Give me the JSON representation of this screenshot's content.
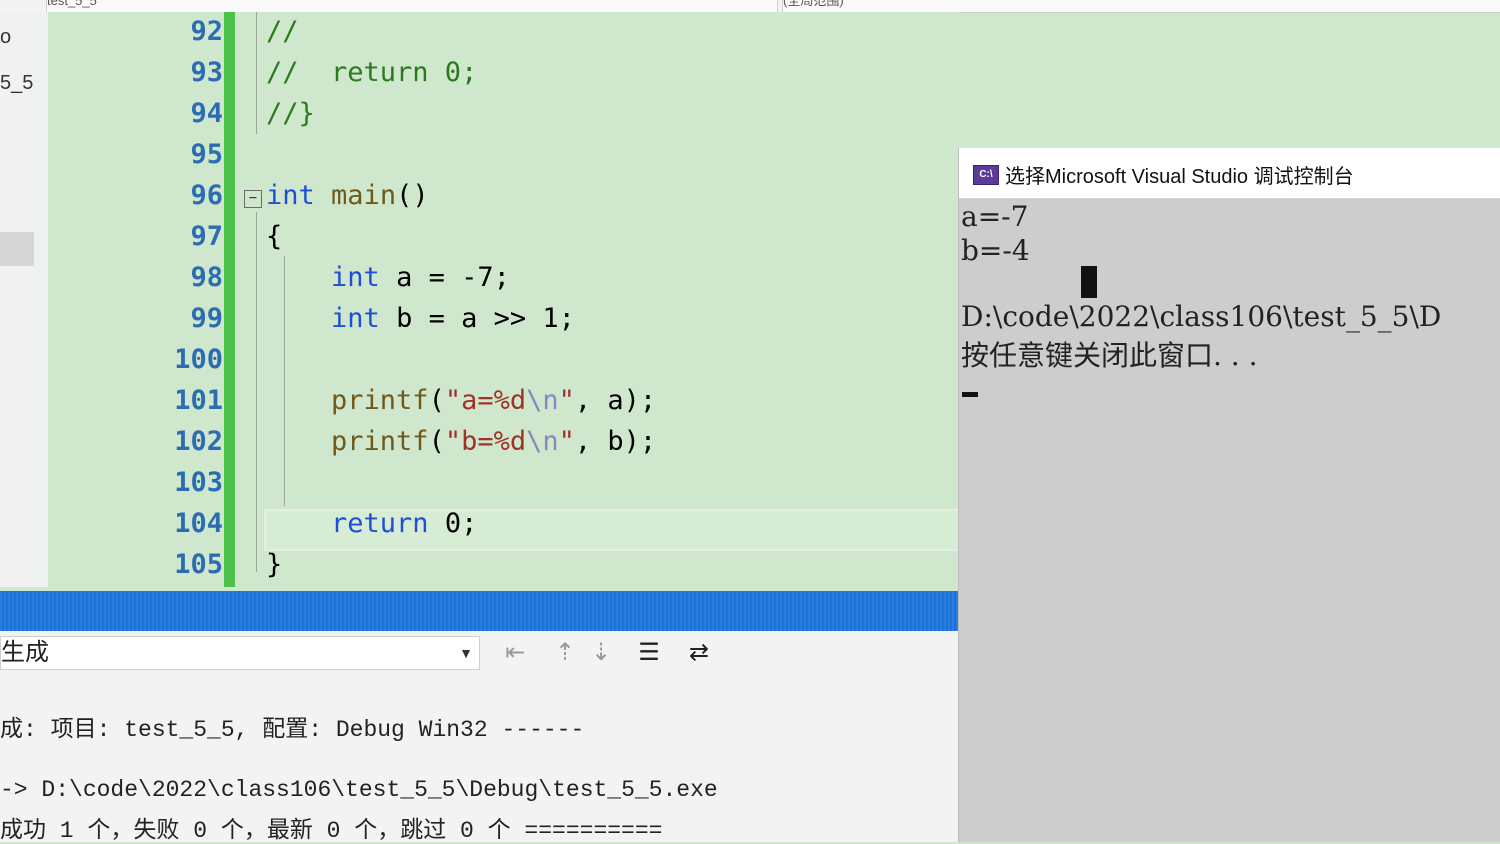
{
  "top_tabs": {
    "file_tab": "test_5_5",
    "scope_tab": "(全局范围)"
  },
  "left_panel": {
    "frag1": "o",
    "frag2": "5_5"
  },
  "editor": {
    "lines": [
      {
        "num": "92",
        "text": "//"
      },
      {
        "num": "93",
        "text": "//  return 0;"
      },
      {
        "num": "94",
        "text": "//}"
      },
      {
        "num": "95",
        "text": ""
      },
      {
        "num": "96",
        "text": "int main()"
      },
      {
        "num": "97",
        "text": "{"
      },
      {
        "num": "98",
        "text": "    int a = -7;"
      },
      {
        "num": "99",
        "text": "    int b = a >> 1;"
      },
      {
        "num": "100",
        "text": ""
      },
      {
        "num": "101",
        "text": "    printf(\"a=%d\\n\", a);"
      },
      {
        "num": "102",
        "text": "    printf(\"b=%d\\n\", b);"
      },
      {
        "num": "103",
        "text": ""
      },
      {
        "num": "104",
        "text": "    return 0;"
      },
      {
        "num": "105",
        "text": "}"
      }
    ],
    "fold_glyph": "−"
  },
  "output": {
    "combo_value": "生成",
    "line1": "成: 项目: test_5_5, 配置: Debug Win32 ------",
    "line2": "-> D:\\code\\2022\\class106\\test_5_5\\Debug\\test_5_5.exe",
    "line3": "成功 1 个，失败 0 个，最新 0 个，跳过 0 个 =========="
  },
  "console": {
    "title": "选择Microsoft Visual Studio 调试控制台",
    "icon_text": "C:\\",
    "line1": "a=-7",
    "line2": "b=-4",
    "line3": "D:\\code\\2022\\class106\\test_5_5\\D",
    "line4": "按任意键关闭此窗口. . ."
  }
}
